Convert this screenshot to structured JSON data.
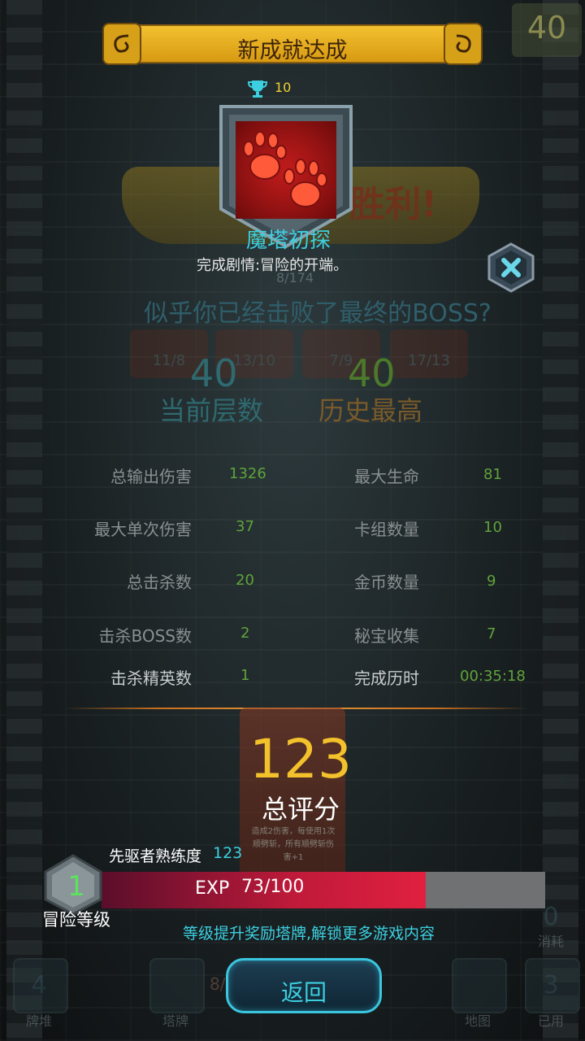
{
  "popup": {
    "title": "新成就达成",
    "trophy_points": "10",
    "achievement_name": "魔塔初探",
    "achievement_desc": "完成剧情:冒险的开端。",
    "topright_value": "40"
  },
  "background": {
    "ribbon_text": "胜利!",
    "counter": "8/174",
    "message": "似乎你已经击败了最终的BOSS?",
    "cards": [
      "11/8",
      "13/10",
      "7/9",
      "17/13"
    ],
    "current_floor": {
      "value": "40",
      "label": "当前层数"
    },
    "best_floor": {
      "value": "40",
      "label": "历史最高"
    }
  },
  "stats": {
    "left": [
      {
        "label": "总输出伤害",
        "value": "1326"
      },
      {
        "label": "最大单次伤害",
        "value": "37"
      },
      {
        "label": "总击杀数",
        "value": "20"
      },
      {
        "label": "击杀BOSS数",
        "value": "2"
      },
      {
        "label": "击杀精英数",
        "value": "1"
      }
    ],
    "right": [
      {
        "label": "最大生命",
        "value": "81"
      },
      {
        "label": "卡组数量",
        "value": "10"
      },
      {
        "label": "金币数量",
        "value": "9"
      },
      {
        "label": "秘宝收集",
        "value": "7"
      },
      {
        "label": "完成历时",
        "value": "00:35:18"
      }
    ]
  },
  "score": {
    "value": "123",
    "label": "总评分",
    "card_desc": "造成2伤害，每使用1次顺劈斩，所有顺劈斩伤害+1"
  },
  "progress": {
    "mastery_label": "先驱者熟练度",
    "mastery_value": "123",
    "level": "1",
    "level_label": "冒险等级",
    "exp_label": "EXP",
    "exp_value": "73/100",
    "exp_fraction": 0.73,
    "hint": "等级提升奖励塔牌,解锁更多游戏内容"
  },
  "bottom": {
    "pile_num": "4",
    "pile_label": "牌堆",
    "tower_cards_label": "塔牌",
    "pile_count": "8/80",
    "back_button": "返回",
    "map_label": "地图",
    "used_num": "3",
    "used_label": "已用",
    "consumed_num": "0",
    "consumed_label": "消耗"
  },
  "colors": {
    "accent_cyan": "#3ccfe0",
    "gold": "#f3c12b",
    "stat_green": "#5fa33a",
    "exp_red": "#c01a3a"
  }
}
